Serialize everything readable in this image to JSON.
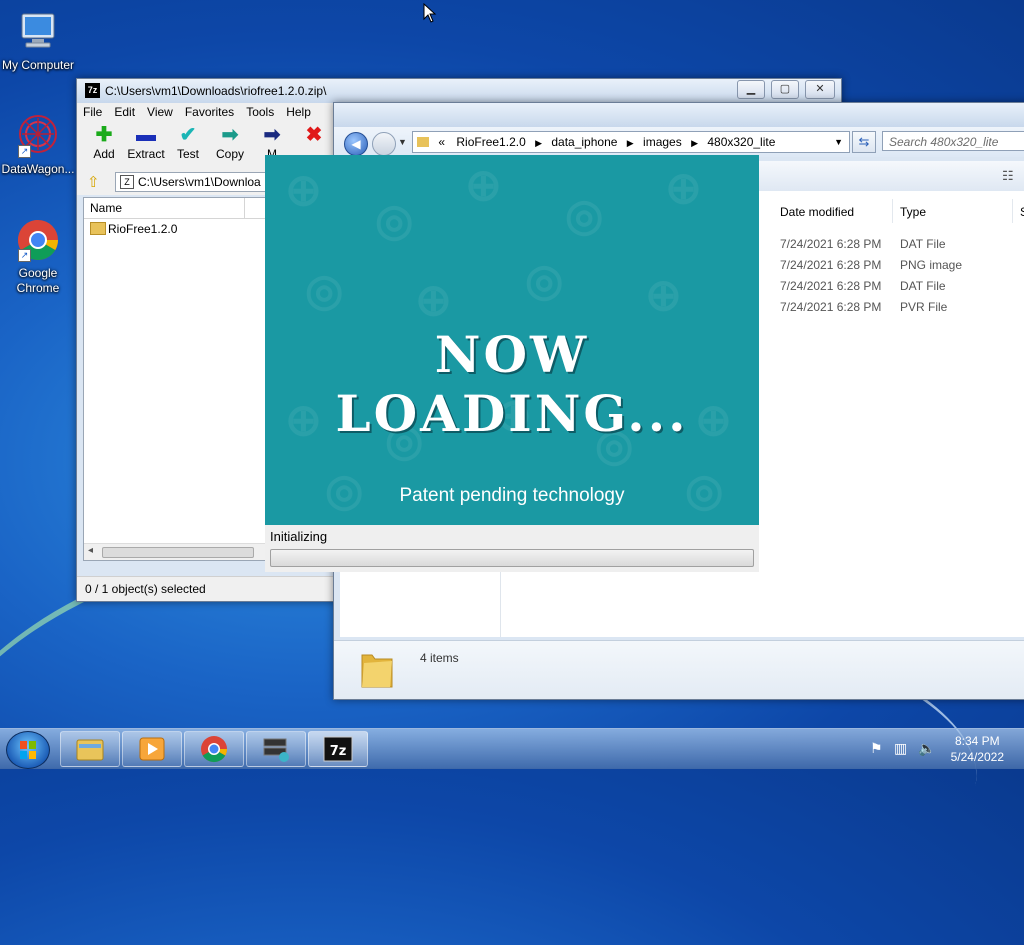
{
  "desktop": {
    "icons": [
      {
        "label": "My Computer",
        "icon": "computer-icon"
      },
      {
        "label": "DataWagon...",
        "icon": "datawagon-icon"
      },
      {
        "label": "Google Chrome",
        "icon": "chrome-icon"
      }
    ]
  },
  "sevenzip": {
    "title": "C:\\Users\\vm1\\Downloads\\riofree1.2.0.zip\\",
    "menu": [
      "File",
      "Edit",
      "View",
      "Favorites",
      "Tools",
      "Help"
    ],
    "toolbar": [
      {
        "label": "Add",
        "icon": "plus-icon"
      },
      {
        "label": "Extract",
        "icon": "minus-icon"
      },
      {
        "label": "Test",
        "icon": "check-icon"
      },
      {
        "label": "Copy",
        "icon": "copy-arrow-icon"
      },
      {
        "label": "M",
        "icon": "move-arrow-icon"
      },
      {
        "label": "",
        "icon": "delete-icon"
      }
    ],
    "address": "C:\\Users\\vm1\\Downloa",
    "column_name": "Name",
    "items": [
      "RioFree1.2.0"
    ],
    "status": "0 / 1 object(s) selected"
  },
  "explorer": {
    "breadcrumb": [
      "«",
      "RioFree1.2.0",
      "data_iphone",
      "images",
      "480x320_lite"
    ],
    "search_placeholder": "Search 480x320_lite",
    "columns": [
      "Date modified",
      "Type",
      "S"
    ],
    "rows": [
      {
        "date": "7/24/2021 6:28 PM",
        "type": "DAT File"
      },
      {
        "date": "7/24/2021 6:28 PM",
        "type": "PNG image"
      },
      {
        "date": "7/24/2021 6:28 PM",
        "type": "DAT File"
      },
      {
        "date": "7/24/2021 6:28 PM",
        "type": "PVR File"
      }
    ],
    "item_count": "4 items"
  },
  "loader": {
    "headline": "NOW LOADING...",
    "tagline": "Patent pending technology",
    "status": "Initializing",
    "progress": 0
  },
  "taskbar": {
    "items": [
      "explorer-icon",
      "media-player-icon",
      "chrome-icon",
      "network-app-icon",
      "7zip-icon"
    ],
    "time": "8:34 PM",
    "date": "5/24/2022"
  },
  "colors": {
    "splash_bg": "#1a99a3",
    "desktop_bg": "#1a64c6"
  }
}
